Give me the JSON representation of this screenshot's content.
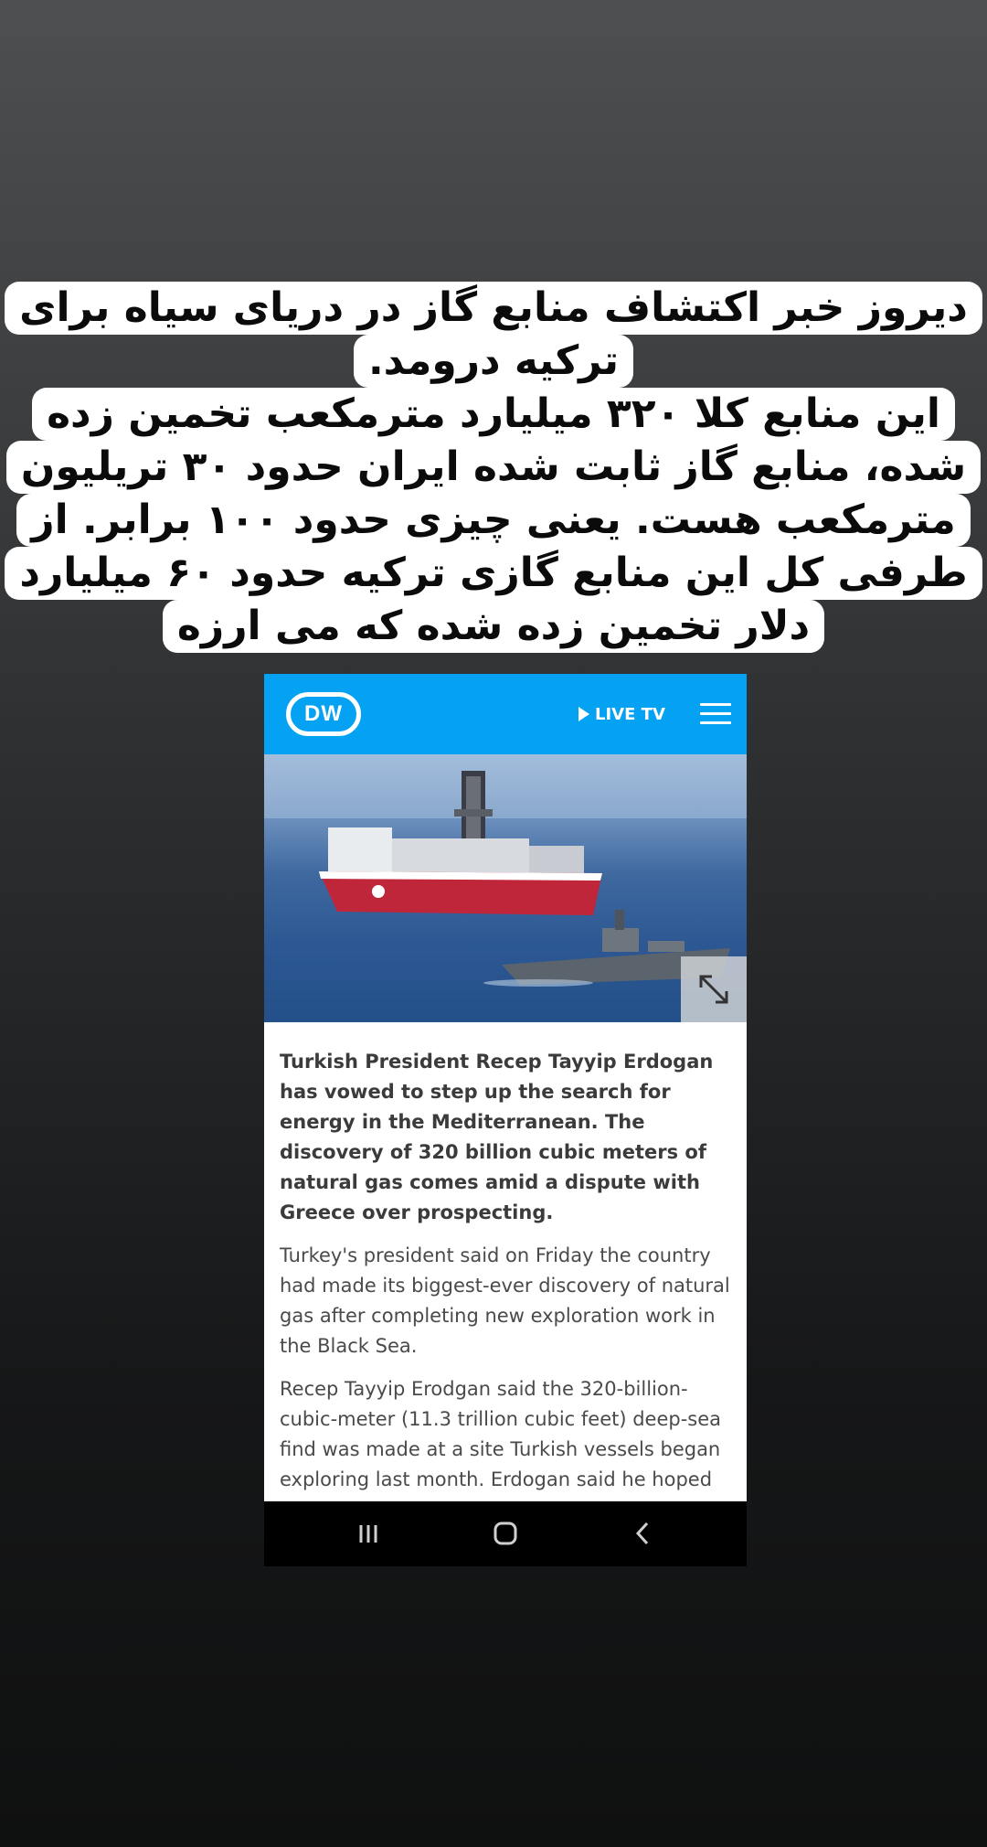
{
  "caption": {
    "lines": [
      "دیروز خبر اکتشاف منابع گاز در دریای سیاه برای",
      "ترکیه درومد.",
      "این منابع کلا ۳۲۰ میلیارد مترمکعب تخمین زده",
      "شده، منابع گاز ثابت شده ایران حدود ۳۰ تریلیون",
      "مترمکعب هست. یعنی چیزی حدود ۱۰۰ برابر. از",
      "طرفی کل این منابع گازی ترکیه حدود ۶۰ میلیارد",
      "دلار تخمین زده شده که می ارزه"
    ]
  },
  "screenshot": {
    "header": {
      "logo_text": "DW",
      "live_tv_label": "LIVE TV",
      "accent_color": "#05a2f4",
      "icons": [
        "play-icon",
        "menu-icon"
      ]
    },
    "hero_image": {
      "icons": [
        "expand-icon"
      ]
    },
    "article": {
      "lead": "Turkish President Recep Tayyip Erdogan has vowed to step up the search for energy in the Mediterranean. The discovery of 320 billion cubic meters of natural gas comes amid a dispute with Greece over prospecting.",
      "paragraphs": [
        "Turkey's president said on Friday the country had made its biggest-ever discovery of natural gas after completing new exploration work in the Black Sea.",
        "Recep Tayyip Erodgan said the 320-billion-cubic-meter (11.3 trillion cubic feet) deep-sea find was made at a site Turkish vessels began exploring last month. Erdogan said he hoped"
      ]
    },
    "navbar": {
      "icons": [
        "recent-apps-icon",
        "home-icon",
        "back-icon"
      ]
    }
  }
}
